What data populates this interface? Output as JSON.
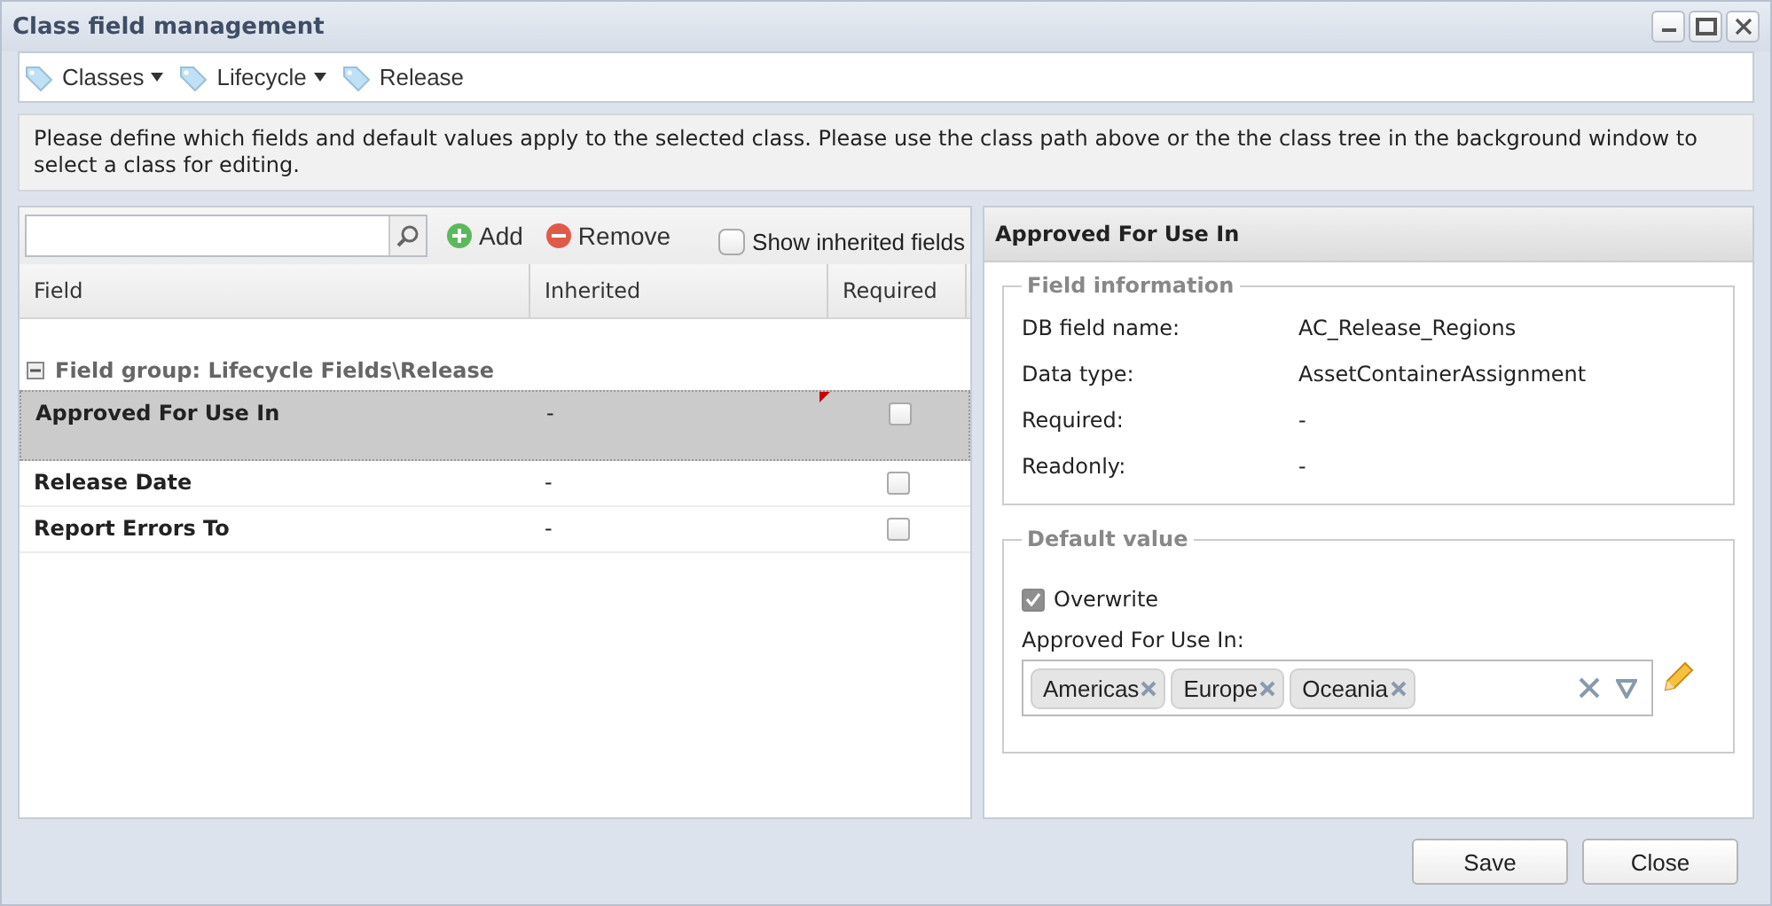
{
  "window": {
    "title": "Class field management"
  },
  "breadcrumb": [
    {
      "label": "Classes",
      "has_menu": true
    },
    {
      "label": "Lifecycle",
      "has_menu": true
    },
    {
      "label": "Release",
      "has_menu": false
    }
  ],
  "info": "Please define which fields and default values apply to the selected class. Please use the class path above or the the class tree in the background window to select a class for editing.",
  "fields_panel": {
    "add_label": "Add",
    "remove_label": "Remove",
    "show_inherited": {
      "label": "Show inherited fields",
      "checked": false
    },
    "columns": [
      "Field",
      "Inherited",
      "Required"
    ],
    "group": {
      "label": "Field group: Lifecycle Fields\\Release",
      "expanded": true
    },
    "rows": [
      {
        "field": "Approved For Use In",
        "inherited": "-",
        "required": false,
        "selected": true,
        "modified": true
      },
      {
        "field": "Release Date",
        "inherited": "-",
        "required": false,
        "selected": false,
        "modified": false
      },
      {
        "field": "Report Errors To",
        "inherited": "-",
        "required": false,
        "selected": false,
        "modified": false
      }
    ]
  },
  "detail_panel": {
    "title": "Approved For Use In",
    "field_information": {
      "legend": "Field information",
      "items": [
        {
          "label": "DB field name:",
          "value": "AC_Release_Regions"
        },
        {
          "label": "Data type:",
          "value": "AssetContainerAssignment"
        },
        {
          "label": "Required:",
          "value": "-"
        },
        {
          "label": "Readonly:",
          "value": "-"
        }
      ]
    },
    "default_value": {
      "legend": "Default value",
      "overwrite": {
        "label": "Overwrite",
        "checked": true
      },
      "field_label": "Approved For Use In:",
      "tags": [
        "Americas",
        "Europe",
        "Oceania"
      ]
    }
  },
  "buttons": [
    "Save",
    "Close"
  ]
}
